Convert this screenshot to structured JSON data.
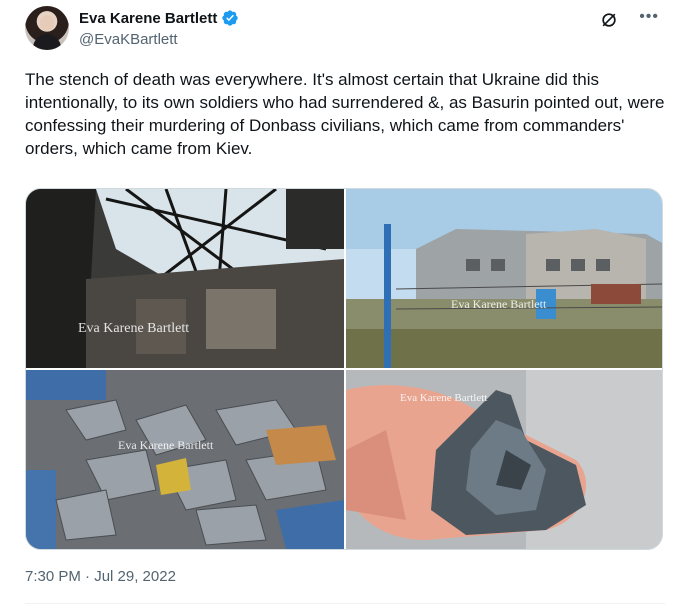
{
  "author": {
    "name": "Eva Karene Bartlett",
    "handle": "@EvaKBartlett",
    "verified": true
  },
  "tweet": {
    "text": "The stench of death was everywhere. It's almost certain that Ukraine did this intentionally, to its own soldiers who had surrendered &, as Basurin pointed out, were confessing their murdering of Donbass civilians, which came from commanders' orders, which came from Kiev.",
    "timestamp": "7:30 PM · Jul 29, 2022"
  },
  "media": {
    "watermarks": [
      "Eva Karene Bartlett",
      "Eva Karene Bartlett",
      "Eva Karene Bartlett",
      "Eva Karene Bartlett"
    ]
  },
  "icons": {
    "verified": "verified-badge-icon",
    "grok": "grok-icon",
    "more": "more-icon"
  },
  "colors": {
    "text": "#0f1419",
    "secondary": "#536471",
    "verified": "#1d9bf0",
    "border": "#cfd9de"
  }
}
